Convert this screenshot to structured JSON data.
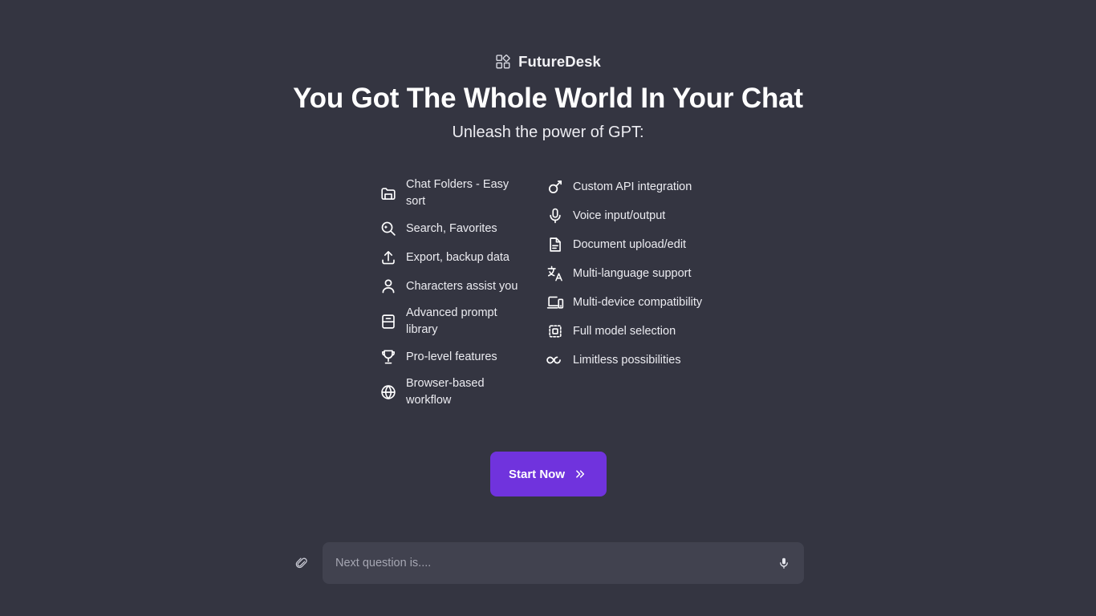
{
  "brand": {
    "name": "FutureDesk",
    "logo_icon": "grid-diamond-logo-icon"
  },
  "hero": {
    "headline": "You Got The Whole World In Your Chat",
    "subhead": "Unleash the power of GPT:"
  },
  "features": {
    "left_column": [
      {
        "label": "Chat Folders - Easy sort",
        "icon": "folder-icon"
      },
      {
        "label": "Search, Favorites",
        "icon": "search-star-icon"
      },
      {
        "label": "Export, backup data",
        "icon": "upload-export-icon"
      },
      {
        "label": "Characters assist you",
        "icon": "user-person-icon"
      },
      {
        "label": "Advanced prompt library",
        "icon": "book-library-icon"
      },
      {
        "label": "Pro-level features",
        "icon": "trophy-icon"
      },
      {
        "label": "Browser-based workflow",
        "icon": "globe-icon"
      }
    ],
    "right_column": [
      {
        "label": "Custom API integration",
        "icon": "api-key-icon"
      },
      {
        "label": "Voice input/output",
        "icon": "microphone-icon"
      },
      {
        "label": "Document upload/edit",
        "icon": "document-icon"
      },
      {
        "label": "Multi-language support",
        "icon": "translate-icon"
      },
      {
        "label": "Multi-device compatibility",
        "icon": "devices-icon"
      },
      {
        "label": "Full model selection",
        "icon": "chip-cpu-icon"
      },
      {
        "label": "Limitless possibilities",
        "icon": "infinity-icon"
      }
    ]
  },
  "cta": {
    "label": "Start Now",
    "icon": "double-chevron-right-icon",
    "background_color": "#7033DD",
    "text_color": "#FFFFFF"
  },
  "composer": {
    "attach_icon": "paperclip-icon",
    "placeholder": "Next question is....",
    "value": "",
    "mic_icon": "microphone-icon"
  },
  "theme": {
    "background": "#343541",
    "input_background": "#41424F",
    "text": "#ECECF1",
    "accent": "#7033DD"
  }
}
